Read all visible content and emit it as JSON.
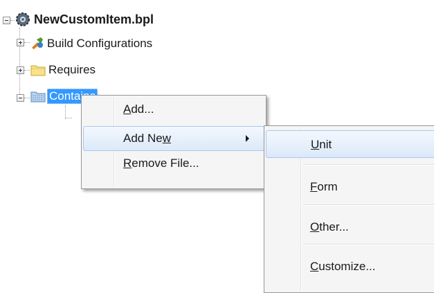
{
  "tree": {
    "root": {
      "label": "NewCustomItem.bpl",
      "expanded": true,
      "icon": "package-gear-icon"
    },
    "children": [
      {
        "label": "Build Configurations",
        "icon": "build-config-icon",
        "expanded": false
      },
      {
        "label": "Requires",
        "icon": "folder-icon",
        "expanded": false
      },
      {
        "label": "Contains",
        "icon": "folder-contains-icon",
        "expanded": true,
        "selected": true
      }
    ]
  },
  "context_menu": {
    "items": [
      {
        "prefix": "",
        "mnemonic": "A",
        "suffix": "dd...",
        "has_submenu": false
      },
      {
        "prefix": "Add Ne",
        "mnemonic": "w",
        "suffix": "",
        "has_submenu": true,
        "highlighted": true
      },
      {
        "prefix": "",
        "mnemonic": "R",
        "suffix": "emove File...",
        "has_submenu": false
      }
    ]
  },
  "submenu": {
    "items": [
      {
        "prefix": "",
        "mnemonic": "U",
        "suffix": "nit",
        "highlighted": true
      },
      {
        "prefix": "",
        "mnemonic": "F",
        "suffix": "orm"
      },
      {
        "prefix": "",
        "mnemonic": "O",
        "suffix": "ther..."
      },
      {
        "prefix": "",
        "mnemonic": "C",
        "suffix": "ustomize..."
      }
    ]
  },
  "colors": {
    "selection": "#3399ff",
    "menu_background": "#f5f5f5",
    "menu_highlight_border": "#a8c8ee"
  }
}
